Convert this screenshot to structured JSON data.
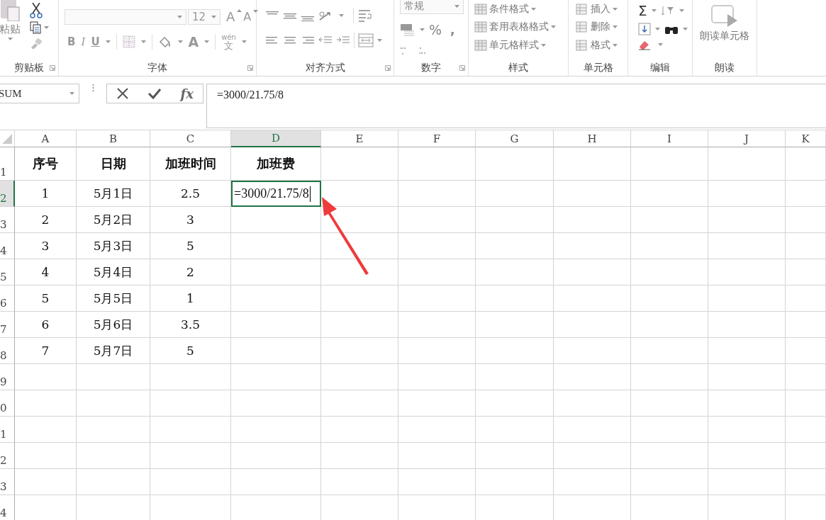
{
  "ribbon": {
    "groups": [
      {
        "kind": "clipboard",
        "label": "剪贴板",
        "buttons": [
          "粘贴"
        ]
      },
      {
        "kind": "font",
        "label": "字体",
        "font_size": "12",
        "buttons": [
          "A",
          "A",
          "B",
          "I",
          "U",
          "A"
        ],
        "phonetic": "wén",
        "phonetic_char": "文"
      },
      {
        "kind": "alignment",
        "label": "对齐方式"
      },
      {
        "kind": "number",
        "label": "数字",
        "format": "常规",
        "buttons": [
          "%",
          ","
        ]
      },
      {
        "kind": "styles",
        "label": "样式",
        "buttons": [
          "条件格式",
          "套用表格格式",
          "单元格样式"
        ]
      },
      {
        "kind": "cells",
        "label": "单元格",
        "buttons": [
          "插入",
          "删除",
          "格式"
        ]
      },
      {
        "kind": "editing",
        "label": "编辑",
        "buttons": [
          "Σ"
        ]
      },
      {
        "kind": "speech",
        "label": "朗读",
        "buttons": [
          "朗读单元格"
        ]
      }
    ]
  },
  "formula_bar": {
    "name_box": "SUM",
    "function_button": "fx",
    "formula": "=3000/21.75/8"
  },
  "sheet": {
    "columns": [
      {
        "label": "A",
        "selected": false
      },
      {
        "label": "B",
        "selected": false
      },
      {
        "label": "C",
        "selected": false
      },
      {
        "label": "D",
        "selected": true
      },
      {
        "label": "E",
        "selected": false
      },
      {
        "label": "F",
        "selected": false
      },
      {
        "label": "G",
        "selected": false
      },
      {
        "label": "H",
        "selected": false
      },
      {
        "label": "I",
        "selected": false
      },
      {
        "label": "J",
        "selected": false
      },
      {
        "label": "K",
        "selected": false
      }
    ],
    "rows": [
      {
        "label": "1",
        "kind": "header",
        "selected": false,
        "cells": [
          "序号",
          "日期",
          "加班时间",
          "加班费"
        ]
      },
      {
        "label": "2",
        "kind": "data",
        "selected": true,
        "cells": [
          "1",
          "5月1日",
          "2.5",
          "=3000/21.75/8"
        ]
      },
      {
        "label": "3",
        "kind": "data",
        "selected": false,
        "cells": [
          "2",
          "5月2日",
          "3"
        ]
      },
      {
        "label": "4",
        "kind": "data",
        "selected": false,
        "cells": [
          "3",
          "5月3日",
          "5"
        ]
      },
      {
        "label": "5",
        "kind": "data",
        "selected": false,
        "cells": [
          "4",
          "5月4日",
          "2"
        ]
      },
      {
        "label": "6",
        "kind": "data",
        "selected": false,
        "cells": [
          "5",
          "5月5日",
          "1"
        ]
      },
      {
        "label": "7",
        "kind": "data",
        "selected": false,
        "cells": [
          "6",
          "5月6日",
          "3.5"
        ]
      },
      {
        "label": "8",
        "kind": "data",
        "selected": false,
        "cells": [
          "7",
          "5月7日",
          "5"
        ]
      },
      {
        "label": "9",
        "kind": "data",
        "selected": false,
        "cells": []
      },
      {
        "label": "0",
        "kind": "data",
        "selected": false,
        "cells": []
      },
      {
        "label": "1",
        "kind": "data",
        "selected": false,
        "cells": []
      },
      {
        "label": "2",
        "kind": "data",
        "selected": false,
        "cells": []
      },
      {
        "label": "3",
        "kind": "data",
        "selected": false,
        "cells": []
      },
      {
        "label": "4",
        "kind": "data",
        "selected": false,
        "cells": []
      }
    ]
  }
}
